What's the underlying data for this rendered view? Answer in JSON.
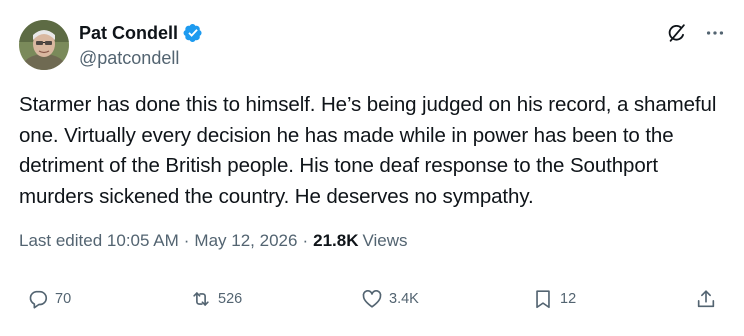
{
  "author": {
    "display_name": "Pat Condell",
    "handle": "@patcondell",
    "verified": true
  },
  "icons": {
    "verified": "verified-badge-icon",
    "grok": "grok-icon",
    "more": "more-options-icon",
    "reply": "reply-icon",
    "repost": "repost-icon",
    "like": "like-icon",
    "bookmark": "bookmark-icon",
    "share": "share-icon"
  },
  "tweet": {
    "text": "Starmer has done this to himself. He’s being judged on his record, a shameful one. Virtually every decision he has made while in power has been to the detriment of the British people. His tone deaf response to the Southport murders sickened the country. He deserves no sympathy."
  },
  "meta": {
    "edited_label": "Last edited",
    "time": "10:05 AM",
    "separator": "·",
    "date": "May 12, 2026",
    "views_count": "21.8K",
    "views_label": "Views"
  },
  "stats": {
    "replies": "70",
    "reposts": "526",
    "likes": "3.4K",
    "bookmarks": "12"
  },
  "colors": {
    "text": "#0f1419",
    "secondary": "#536471",
    "verified_blue": "#1d9bf0",
    "background": "#ffffff"
  }
}
